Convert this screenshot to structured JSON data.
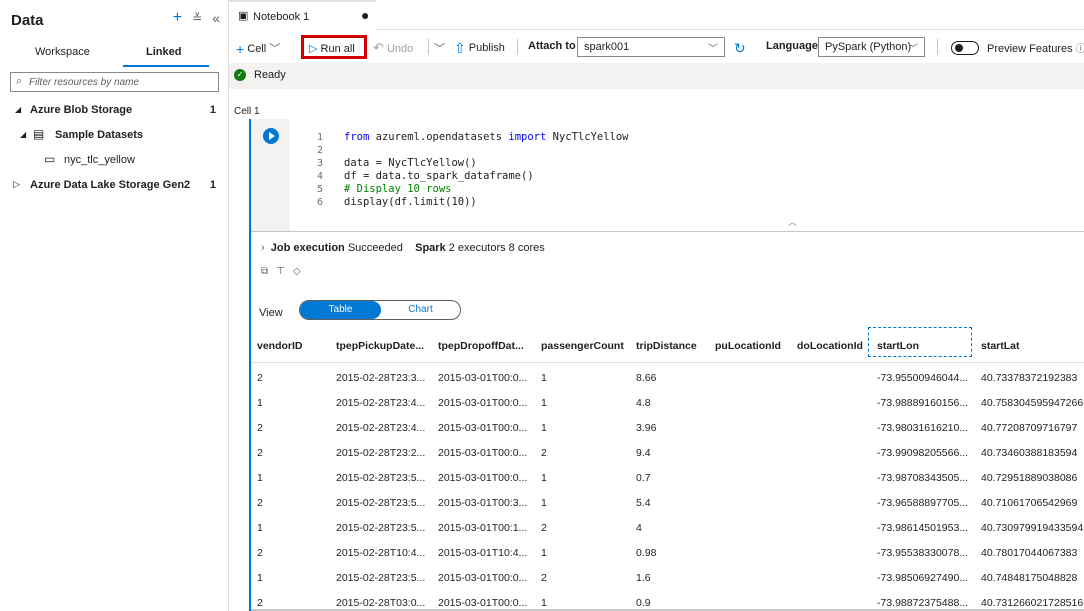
{
  "left_panel": {
    "title": "Data",
    "icons": [
      "plus-icon",
      "collapse-all-icon",
      "collapse-panel-icon"
    ],
    "tabs": {
      "workspace": "Workspace",
      "linked": "Linked"
    },
    "filter_placeholder": "Filter resources by name",
    "tree": {
      "blob": {
        "label": "Azure Blob Storage",
        "count": "1"
      },
      "sample": {
        "label": "Sample Datasets"
      },
      "nyc": {
        "label": "nyc_tlc_yellow"
      },
      "adls": {
        "label": "Azure Data Lake Storage Gen2",
        "count": "1"
      }
    }
  },
  "notebook_tab": {
    "name": "Notebook 1",
    "modified_dot": "●"
  },
  "toolbar": {
    "cell": "Cell",
    "run_all": "Run all",
    "undo": "Undo",
    "publish": "Publish",
    "attach_to_label": "Attach to",
    "attach_to_value": "spark001",
    "language_label": "Language",
    "language_value": "PySpark (Python)",
    "preview_features": "Preview Features"
  },
  "status": {
    "text": "Ready"
  },
  "cell": {
    "label": "Cell 1",
    "code_lines": [
      {
        "n": "1",
        "parts": [
          [
            "kw",
            "from"
          ],
          [
            "",
            " azureml.opendatasets "
          ],
          [
            "kw",
            "import"
          ],
          [
            "",
            " NycTlcYellow"
          ]
        ]
      },
      {
        "n": "2",
        "parts": []
      },
      {
        "n": "3",
        "parts": [
          [
            "",
            "data = NycTlcYellow()"
          ]
        ]
      },
      {
        "n": "4",
        "parts": [
          [
            "",
            "df = data.to_spark_dataframe()"
          ]
        ]
      },
      {
        "n": "5",
        "parts": [
          [
            "cm",
            "# Display 10 rows"
          ]
        ]
      },
      {
        "n": "6",
        "parts": [
          [
            "",
            "display(df.limit(10))"
          ]
        ]
      }
    ],
    "job": {
      "label": "Job execution",
      "status": "Succeeded",
      "spark_label": "Spark",
      "spark_info": "2 executors 8 cores"
    },
    "view": {
      "label": "View",
      "table": "Table",
      "chart": "Chart"
    },
    "table": {
      "columns": [
        "vendorID",
        "tpepPickupDate...",
        "tpepDropoffDat...",
        "passengerCount",
        "tripDistance",
        "puLocationId",
        "doLocationId",
        "startLon",
        "startLat"
      ],
      "rows": [
        [
          "2",
          "2015-02-28T23:3...",
          "2015-03-01T00:0...",
          "1",
          "8.66",
          "",
          "",
          "-73.95500946044...",
          "40.73378372192383"
        ],
        [
          "1",
          "2015-02-28T23:4...",
          "2015-03-01T00:0...",
          "1",
          "4.8",
          "",
          "",
          "-73.98889160156...",
          "40.758304595947266"
        ],
        [
          "2",
          "2015-02-28T23:4...",
          "2015-03-01T00:0...",
          "1",
          "3.96",
          "",
          "",
          "-73.98031616210...",
          "40.77208709716797"
        ],
        [
          "2",
          "2015-02-28T23:2...",
          "2015-03-01T00:0...",
          "2",
          "9.4",
          "",
          "",
          "-73.99098205566...",
          "40.73460388183594"
        ],
        [
          "1",
          "2015-02-28T23:5...",
          "2015-03-01T00:0...",
          "1",
          "0.7",
          "",
          "",
          "-73.98708343505...",
          "40.72951889038086"
        ],
        [
          "2",
          "2015-02-28T23:5...",
          "2015-03-01T00:3...",
          "1",
          "5.4",
          "",
          "",
          "-73.96588897705...",
          "40.71061706542969"
        ],
        [
          "1",
          "2015-02-28T23:5...",
          "2015-03-01T00:1...",
          "2",
          "4",
          "",
          "",
          "-73.98614501953...",
          "40.730979919433594"
        ],
        [
          "2",
          "2015-02-28T10:4...",
          "2015-03-01T10:4...",
          "1",
          "0.98",
          "",
          "",
          "-73.95538330078...",
          "40.78017044067383"
        ],
        [
          "1",
          "2015-02-28T23:5...",
          "2015-03-01T00:0...",
          "2",
          "1.6",
          "",
          "",
          "-73.98506927490...",
          "40.74848175048828"
        ],
        [
          "2",
          "2015-02-28T03:0...",
          "2015-03-01T00:0...",
          "1",
          "0.9",
          "",
          "",
          "-73.98872375488...",
          "40.731266021728516"
        ]
      ]
    }
  },
  "colors": {
    "accent": "#0078d4",
    "highlight": "#d00000",
    "success": "#107c10"
  }
}
